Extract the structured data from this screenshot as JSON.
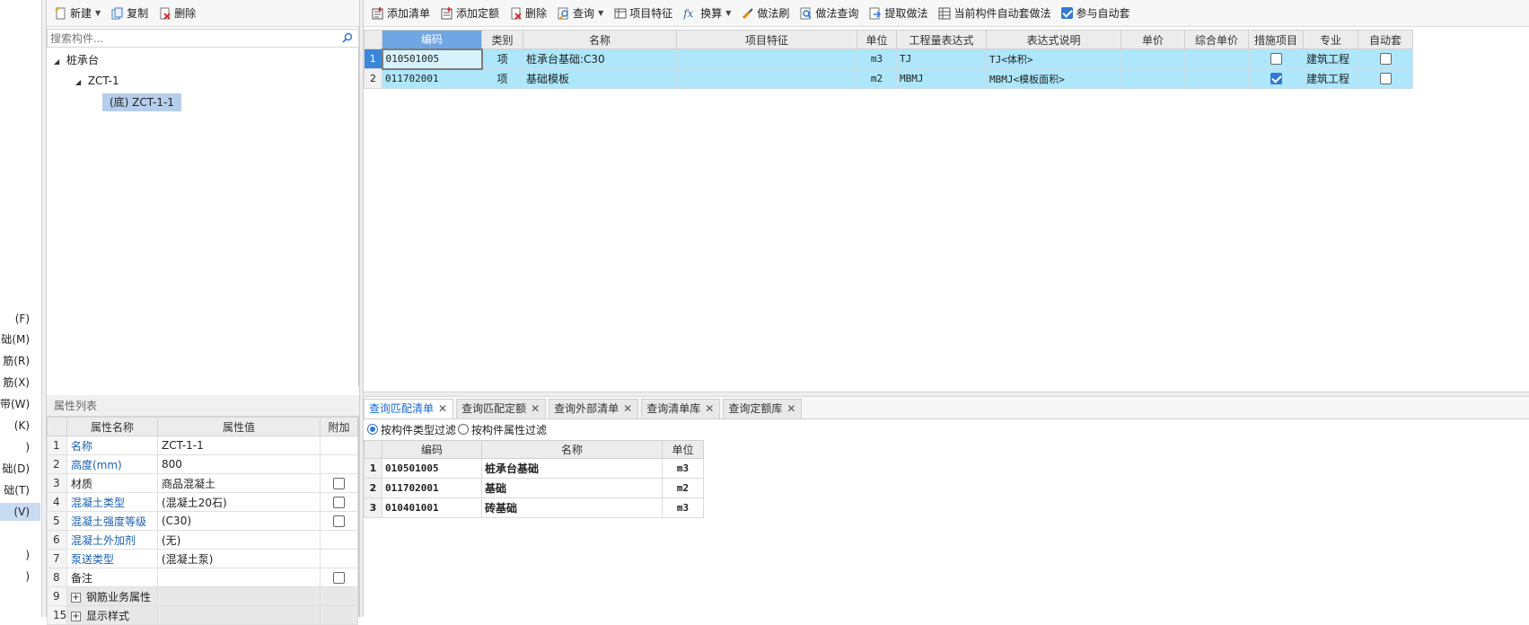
{
  "left_strip": {
    "items": [
      {
        "label": "(F)"
      },
      {
        "label": "础(M)"
      },
      {
        "label": "筋(R)"
      },
      {
        "label": "筋(X)"
      },
      {
        "label": "带(W)"
      },
      {
        "label": "(K)"
      },
      {
        "label": ")"
      },
      {
        "label": "础(D)"
      },
      {
        "label": "础(T)"
      },
      {
        "label": "(V)"
      },
      {
        "label": ")"
      },
      {
        "label": ")"
      },
      {
        "label": ""
      }
    ]
  },
  "component_toolbar": {
    "new_label": "新建",
    "copy_label": "复制",
    "delete_label": "删除"
  },
  "component_search": {
    "placeholder": "搜索构件..."
  },
  "tree": {
    "root": "桩承台",
    "child": "ZCT-1",
    "leaf": "(底) ZCT-1-1"
  },
  "properties": {
    "title": "属性列表",
    "headers": [
      "属性名称",
      "属性值",
      "附加"
    ],
    "rows": [
      {
        "num": "1",
        "name": "名称",
        "value": "ZCT-1-1"
      },
      {
        "num": "2",
        "name": "高度(mm)",
        "value": "800"
      },
      {
        "num": "3",
        "name": "材质",
        "value": "商品混凝土"
      },
      {
        "num": "4",
        "name": "混凝土类型",
        "value": "(混凝土20石)"
      },
      {
        "num": "5",
        "name": "混凝土强度等级",
        "value": "(C30)"
      },
      {
        "num": "6",
        "name": "混凝土外加剂",
        "value": "(无)"
      },
      {
        "num": "7",
        "name": "泵送类型",
        "value": "(混凝土泵)"
      },
      {
        "num": "8",
        "name": "备注",
        "value": ""
      },
      {
        "num": "9",
        "name": "钢筋业务属性",
        "value": ""
      },
      {
        "num": "15",
        "name": "显示样式",
        "value": ""
      }
    ]
  },
  "main_toolbar": {
    "add_list": "添加清单",
    "add_quota": "添加定额",
    "delete": "删除",
    "query": "查询",
    "item_feature": "项目特征",
    "convert": "换算",
    "method_brush": "做法刷",
    "method_query": "做法查询",
    "extract_method": "提取做法",
    "current_auto": "当前构件自动套做法",
    "join_auto": "参与自动套"
  },
  "main_table": {
    "headers": [
      "编码",
      "类别",
      "名称",
      "项目特征",
      "单位",
      "工程量表达式",
      "表达式说明",
      "单价",
      "综合单价",
      "措施项目",
      "专业",
      "自动套"
    ],
    "rows": [
      {
        "num": "1",
        "code": "010501005",
        "type": "项",
        "name": "桩承台基础:C30",
        "feature": "",
        "unit": "m3",
        "expr": "TJ",
        "expr_desc": "TJ<体积>",
        "price": "",
        "total_price": "",
        "measure": false,
        "major": "建筑工程",
        "auto": false
      },
      {
        "num": "2",
        "code": "011702001",
        "type": "项",
        "name": "基础模板",
        "feature": "",
        "unit": "m2",
        "expr": "MBMJ",
        "expr_desc": "MBMJ<模板面积>",
        "price": "",
        "total_price": "",
        "measure": true,
        "major": "建筑工程",
        "auto": false
      }
    ]
  },
  "bottom_tabs": [
    {
      "label": "查询匹配清单"
    },
    {
      "label": "查询匹配定额"
    },
    {
      "label": "查询外部清单"
    },
    {
      "label": "查询清单库"
    },
    {
      "label": "查询定额库"
    }
  ],
  "filter": {
    "by_type": "按构件类型过滤",
    "by_attr": "按构件属性过滤"
  },
  "query_table": {
    "headers": [
      "编码",
      "名称",
      "单位"
    ],
    "rows": [
      {
        "num": "1",
        "code": "010501005",
        "name": "桩承台基础",
        "unit": "m3"
      },
      {
        "num": "2",
        "code": "011702001",
        "name": "基础",
        "unit": "m2"
      },
      {
        "num": "3",
        "code": "010401001",
        "name": "砖基础",
        "unit": "m3"
      }
    ]
  },
  "colors": {
    "selected_row": "#aee7fb",
    "header_highlight": "#6fa6e4",
    "link_blue": "#1a5fb4",
    "active_tab": "#1a6ad1"
  }
}
